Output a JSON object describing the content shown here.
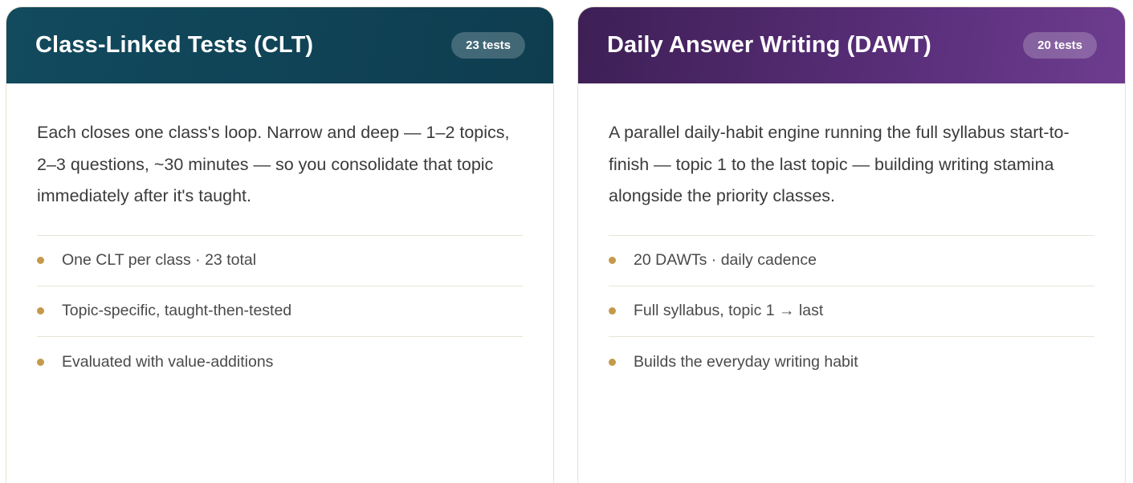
{
  "cards": [
    {
      "title": "Class-Linked Tests (CLT)",
      "badge": "23 tests",
      "description": "Each closes one class's loop. Narrow and deep — 1–2 topics, 2–3 questions, ~30 minutes — so you consolidate that topic immediately after it's taught.",
      "items": [
        "One CLT per class · 23 total",
        "Topic-specific, taught-then-tested",
        "Evaluated with value-additions"
      ]
    },
    {
      "title": "Daily Answer Writing (DAWT)",
      "badge": "20 tests",
      "description": "A parallel daily-habit engine running the full syllabus start-to-finish — topic 1 to the last topic — building writing stamina alongside the priority classes.",
      "items": [
        "20 DAWTs · daily cadence",
        "Full syllabus, topic 1 → last",
        "Builds the everyday writing habit"
      ]
    }
  ],
  "colors": {
    "clt_header": "#124a5e",
    "dawt_header": "#5a2f7a",
    "bullet": "#c49a4a",
    "divider": "#e9e4d6"
  }
}
